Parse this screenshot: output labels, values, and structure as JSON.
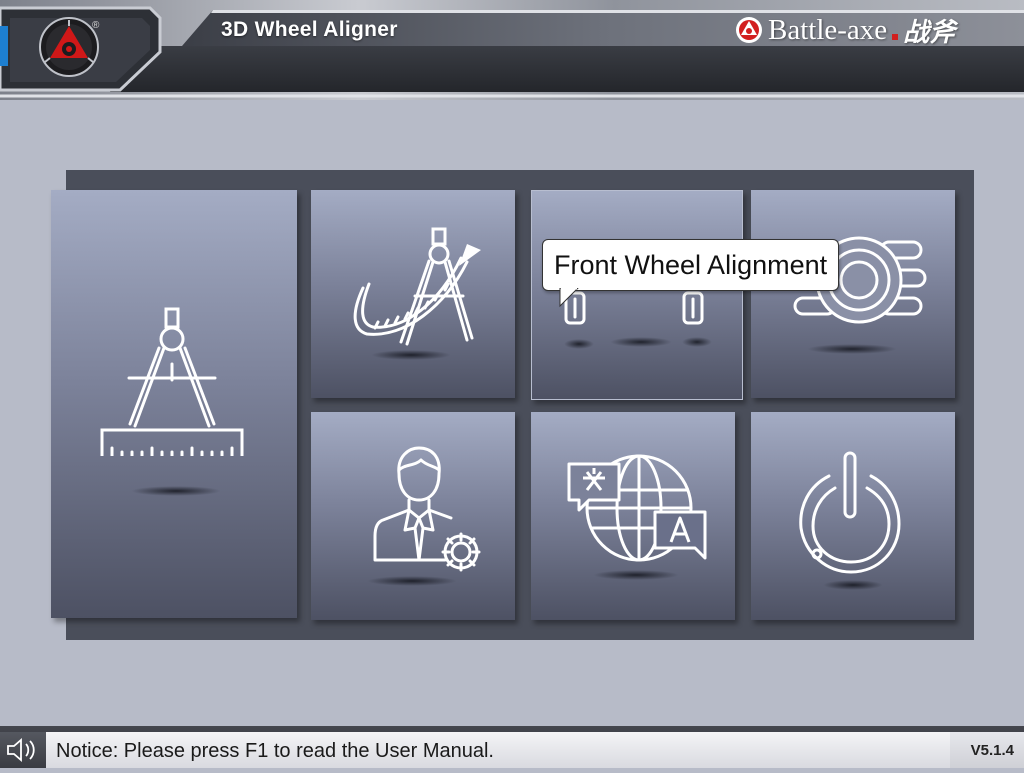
{
  "header": {
    "title": "3D Wheel Aligner",
    "brand": "Battle-axe",
    "brand_cn": "战斧",
    "registered_mark": "®"
  },
  "tiles": [
    {
      "name": "measure",
      "icon": "compass-ruler-icon"
    },
    {
      "name": "measure-angle",
      "icon": "compass-arrow-icon"
    },
    {
      "name": "front-wheel-alignment",
      "icon": "front-wheels-icon"
    },
    {
      "name": "tire-rims",
      "icon": "wheel-tire-icon"
    },
    {
      "name": "user-settings",
      "icon": "user-gear-icon"
    },
    {
      "name": "language",
      "icon": "globe-language-icon"
    },
    {
      "name": "power",
      "icon": "power-icon"
    }
  ],
  "tooltip": {
    "text": "Front Wheel Alignment"
  },
  "status": {
    "notice": "Notice: Please press F1 to read the User Manual.",
    "version": "V5.1.4",
    "speaker_icon": "speaker-icon"
  },
  "colors": {
    "background": "#b7bbc8",
    "panel": "#4a4e5a",
    "tile_top": "#a4acc4",
    "tile_bottom": "#4d5163",
    "brand_red": "#d21f1f"
  }
}
